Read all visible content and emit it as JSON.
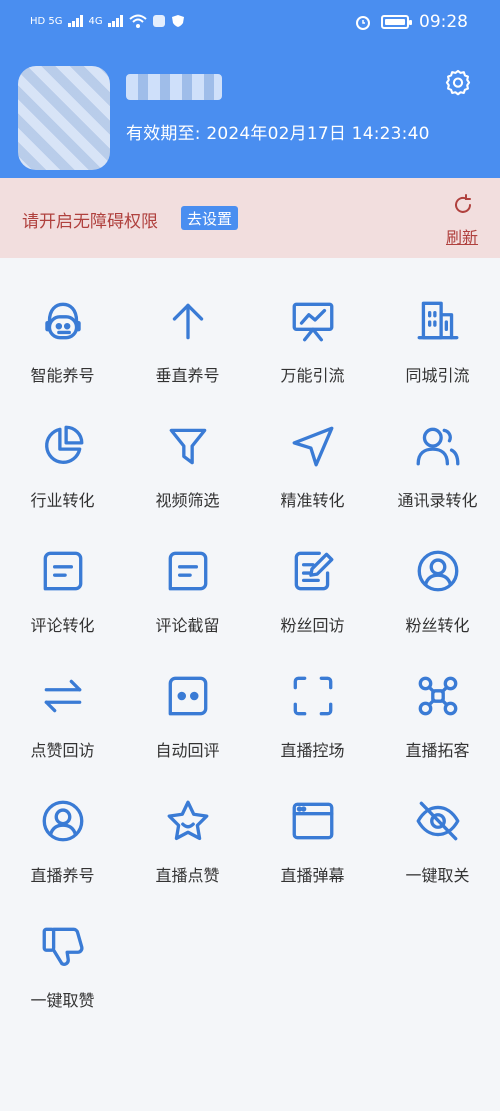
{
  "status_bar": {
    "time": "09:28",
    "signal_left": "HD 5G",
    "signal_right": "4G"
  },
  "profile": {
    "username_masked": "",
    "expire_label": "有效期至:",
    "expire_value": "2024年02月17日 14:23:40"
  },
  "notice": {
    "text": "请开启无障碍权限",
    "button_label": "去设置",
    "refresh_label": "刷新"
  },
  "colors": {
    "header": "#4a8ef0",
    "icon": "#3a7bd5",
    "notice_bg": "#f2dede",
    "notice_text": "#b0413e"
  },
  "grid": [
    {
      "label": "智能养号",
      "icon": "robot-icon"
    },
    {
      "label": "垂直养号",
      "icon": "arrow-up-icon"
    },
    {
      "label": "万能引流",
      "icon": "presentation-chart-icon"
    },
    {
      "label": "同城引流",
      "icon": "building-icon"
    },
    {
      "label": "行业转化",
      "icon": "pie-chart-icon"
    },
    {
      "label": "视频筛选",
      "icon": "filter-icon"
    },
    {
      "label": "精准转化",
      "icon": "navigation-icon"
    },
    {
      "label": "通讯录转化",
      "icon": "contacts-icon"
    },
    {
      "label": "评论转化",
      "icon": "comment-icon"
    },
    {
      "label": "评论截留",
      "icon": "comment-icon"
    },
    {
      "label": "粉丝回访",
      "icon": "edit-note-icon"
    },
    {
      "label": "粉丝转化",
      "icon": "user-circle-icon"
    },
    {
      "label": "点赞回访",
      "icon": "swap-arrows-icon"
    },
    {
      "label": "自动回评",
      "icon": "chat-dots-icon"
    },
    {
      "label": "直播控场",
      "icon": "scan-frame-icon"
    },
    {
      "label": "直播拓客",
      "icon": "network-icon"
    },
    {
      "label": "直播养号",
      "icon": "user-circle-icon"
    },
    {
      "label": "直播点赞",
      "icon": "star-icon"
    },
    {
      "label": "直播弹幕",
      "icon": "window-icon"
    },
    {
      "label": "一键取关",
      "icon": "eye-off-icon"
    },
    {
      "label": "一键取赞",
      "icon": "thumbs-down-icon"
    }
  ]
}
